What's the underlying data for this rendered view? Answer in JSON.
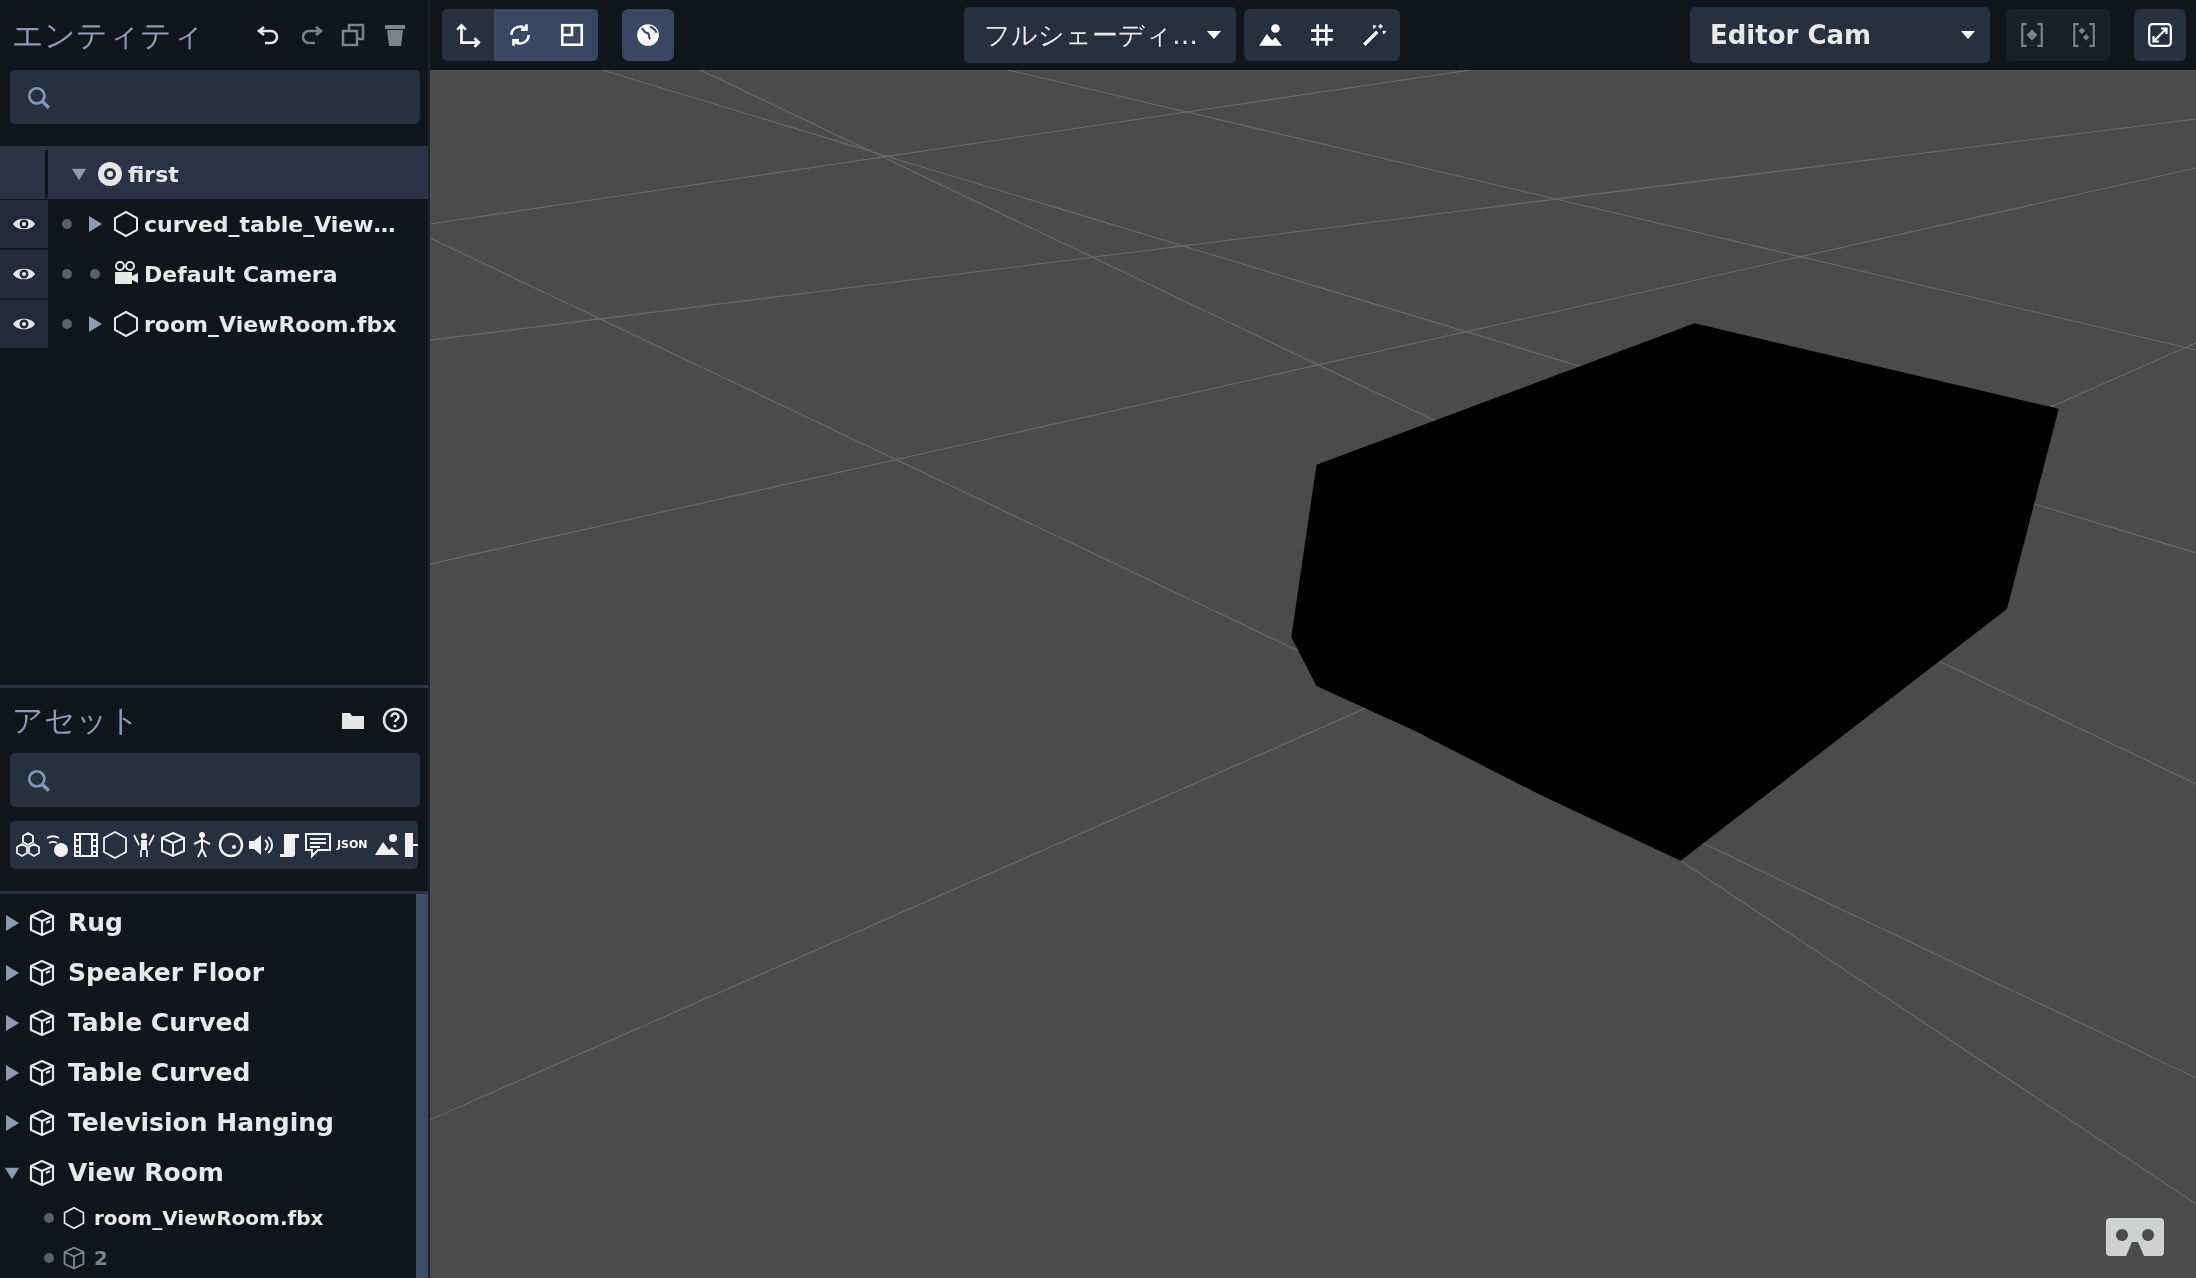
{
  "entities": {
    "title": "エンティティ",
    "tree": [
      {
        "name": "first",
        "kind": "scene",
        "expanded": true,
        "selected": true,
        "children": [
          {
            "name": "curved_table_View…",
            "kind": "model",
            "expanded": false,
            "visible": true,
            "selected": false
          },
          {
            "name": "Default Camera",
            "kind": "camera",
            "visible": true,
            "selected": false
          },
          {
            "name": "room_ViewRoom.fbx",
            "kind": "model",
            "expanded": false,
            "visible": true,
            "selected": false
          }
        ]
      }
    ]
  },
  "assets": {
    "title": "アセット",
    "filter_json_label": "JSON",
    "items": [
      {
        "name": "Rug",
        "expanded": false
      },
      {
        "name": "Speaker Floor",
        "expanded": false
      },
      {
        "name": "Table Curved",
        "expanded": false
      },
      {
        "name": "Table Curved",
        "expanded": false
      },
      {
        "name": "Television Hanging",
        "expanded": false
      },
      {
        "name": "View Room",
        "expanded": true,
        "children": [
          {
            "name": "room_ViewRoom.fbx",
            "kind": "model",
            "disabled": false
          },
          {
            "name": "2",
            "kind": "template",
            "disabled": true
          }
        ]
      }
    ]
  },
  "toolbar": {
    "tools": [
      {
        "kind": "translate",
        "selected": true
      },
      {
        "kind": "rotate",
        "selected": false
      },
      {
        "kind": "scale",
        "selected": false
      }
    ],
    "shading": "フルシェーディ…",
    "camera": "Editor Cam",
    "focus_disabled": true
  }
}
